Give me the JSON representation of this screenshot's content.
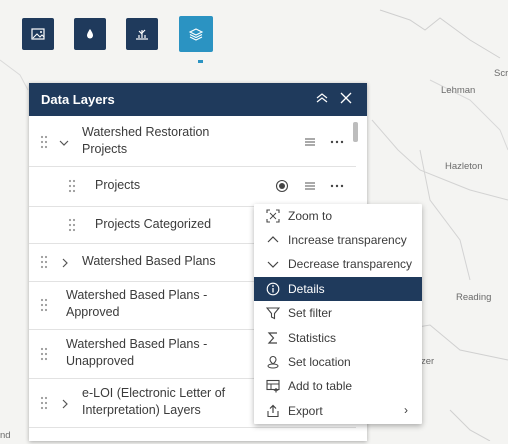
{
  "map": {
    "labels": [
      "Lehman",
      "Hazleton",
      "Reading",
      "Scr",
      "zer",
      "nd"
    ]
  },
  "toolbar": {
    "buttons": [
      "image-icon",
      "water-drop-icon",
      "wetland-icon",
      "layers-icon"
    ],
    "active": "layers-icon",
    "colors": {
      "button": "#1f3a5c",
      "active": "#2b93c2"
    }
  },
  "panel": {
    "title": "Data Layers",
    "layers": [
      {
        "label_l1": "Watershed Restoration",
        "label_l2": "Projects",
        "expanded": true
      },
      {
        "label": "Projects"
      },
      {
        "label": "Projects Categorized"
      },
      {
        "label": "Watershed Based Plans",
        "expanded": false
      },
      {
        "label_l1": "Watershed Based Plans -",
        "label_l2": "Approved"
      },
      {
        "label_l1": "Watershed Based Plans -",
        "label_l2": "Unapproved"
      },
      {
        "label_l1": "e-LOI (Electronic Letter of",
        "label_l2": "Interpretation) Layers",
        "expanded": false
      }
    ]
  },
  "context_menu": {
    "items": [
      {
        "label": "Zoom to",
        "icon": "zoom-to-icon"
      },
      {
        "label": "Increase transparency",
        "icon": "chevron-up-icon"
      },
      {
        "label": "Decrease transparency",
        "icon": "chevron-down-icon"
      },
      {
        "label": "Details",
        "icon": "info-icon",
        "selected": true
      },
      {
        "label": "Set filter",
        "icon": "filter-icon"
      },
      {
        "label": "Statistics",
        "icon": "sigma-icon"
      },
      {
        "label": "Set location",
        "icon": "location-icon"
      },
      {
        "label": "Add to table",
        "icon": "table-add-icon"
      },
      {
        "label": "Export",
        "icon": "export-icon",
        "submenu": "›"
      }
    ]
  }
}
